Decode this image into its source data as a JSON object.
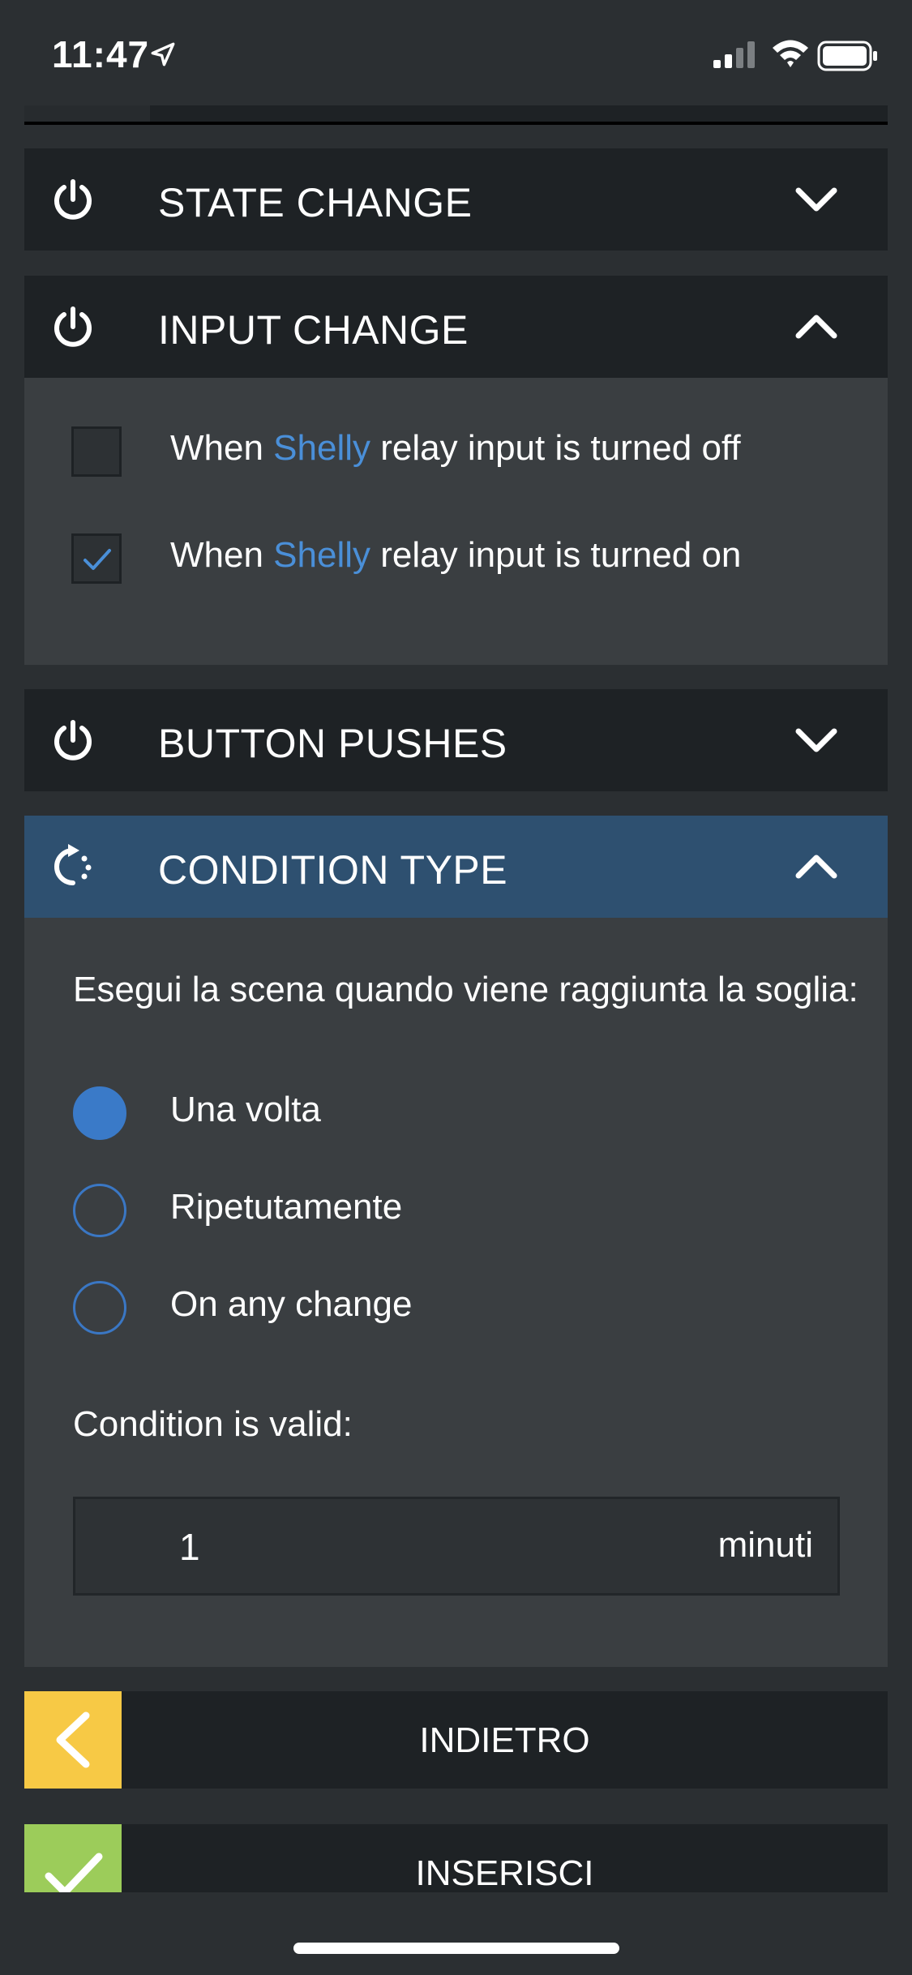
{
  "status_bar": {
    "time": "11:47"
  },
  "sections": {
    "state_change": {
      "title": "STATE CHANGE"
    },
    "input_change": {
      "title": "INPUT CHANGE",
      "options": [
        {
          "prefix": "When ",
          "highlight": "Shelly",
          "suffix": " relay input is turned off",
          "checked": false
        },
        {
          "prefix": "When ",
          "highlight": "Shelly",
          "suffix": " relay input is turned on",
          "checked": true
        }
      ]
    },
    "button_pushes": {
      "title": "BUTTON PUSHES"
    },
    "condition_type": {
      "title": "CONDITION TYPE",
      "prompt": "Esegui la scena quando viene raggiunta la soglia:",
      "options": [
        {
          "label": "Una volta",
          "selected": true
        },
        {
          "label": "Ripetutamente",
          "selected": false
        },
        {
          "label": "On any change",
          "selected": false
        }
      ],
      "validity_label": "Condition is valid:",
      "duration_value": "1",
      "duration_unit": "minuti"
    }
  },
  "actions": {
    "back_label": "INDIETRO",
    "insert_label": "INSERISCI"
  },
  "colors": {
    "accent_blue": "#4a8fd8",
    "active_header": "#2e5070",
    "back_yellow": "#f7c945",
    "insert_green": "#9ccc5a"
  }
}
